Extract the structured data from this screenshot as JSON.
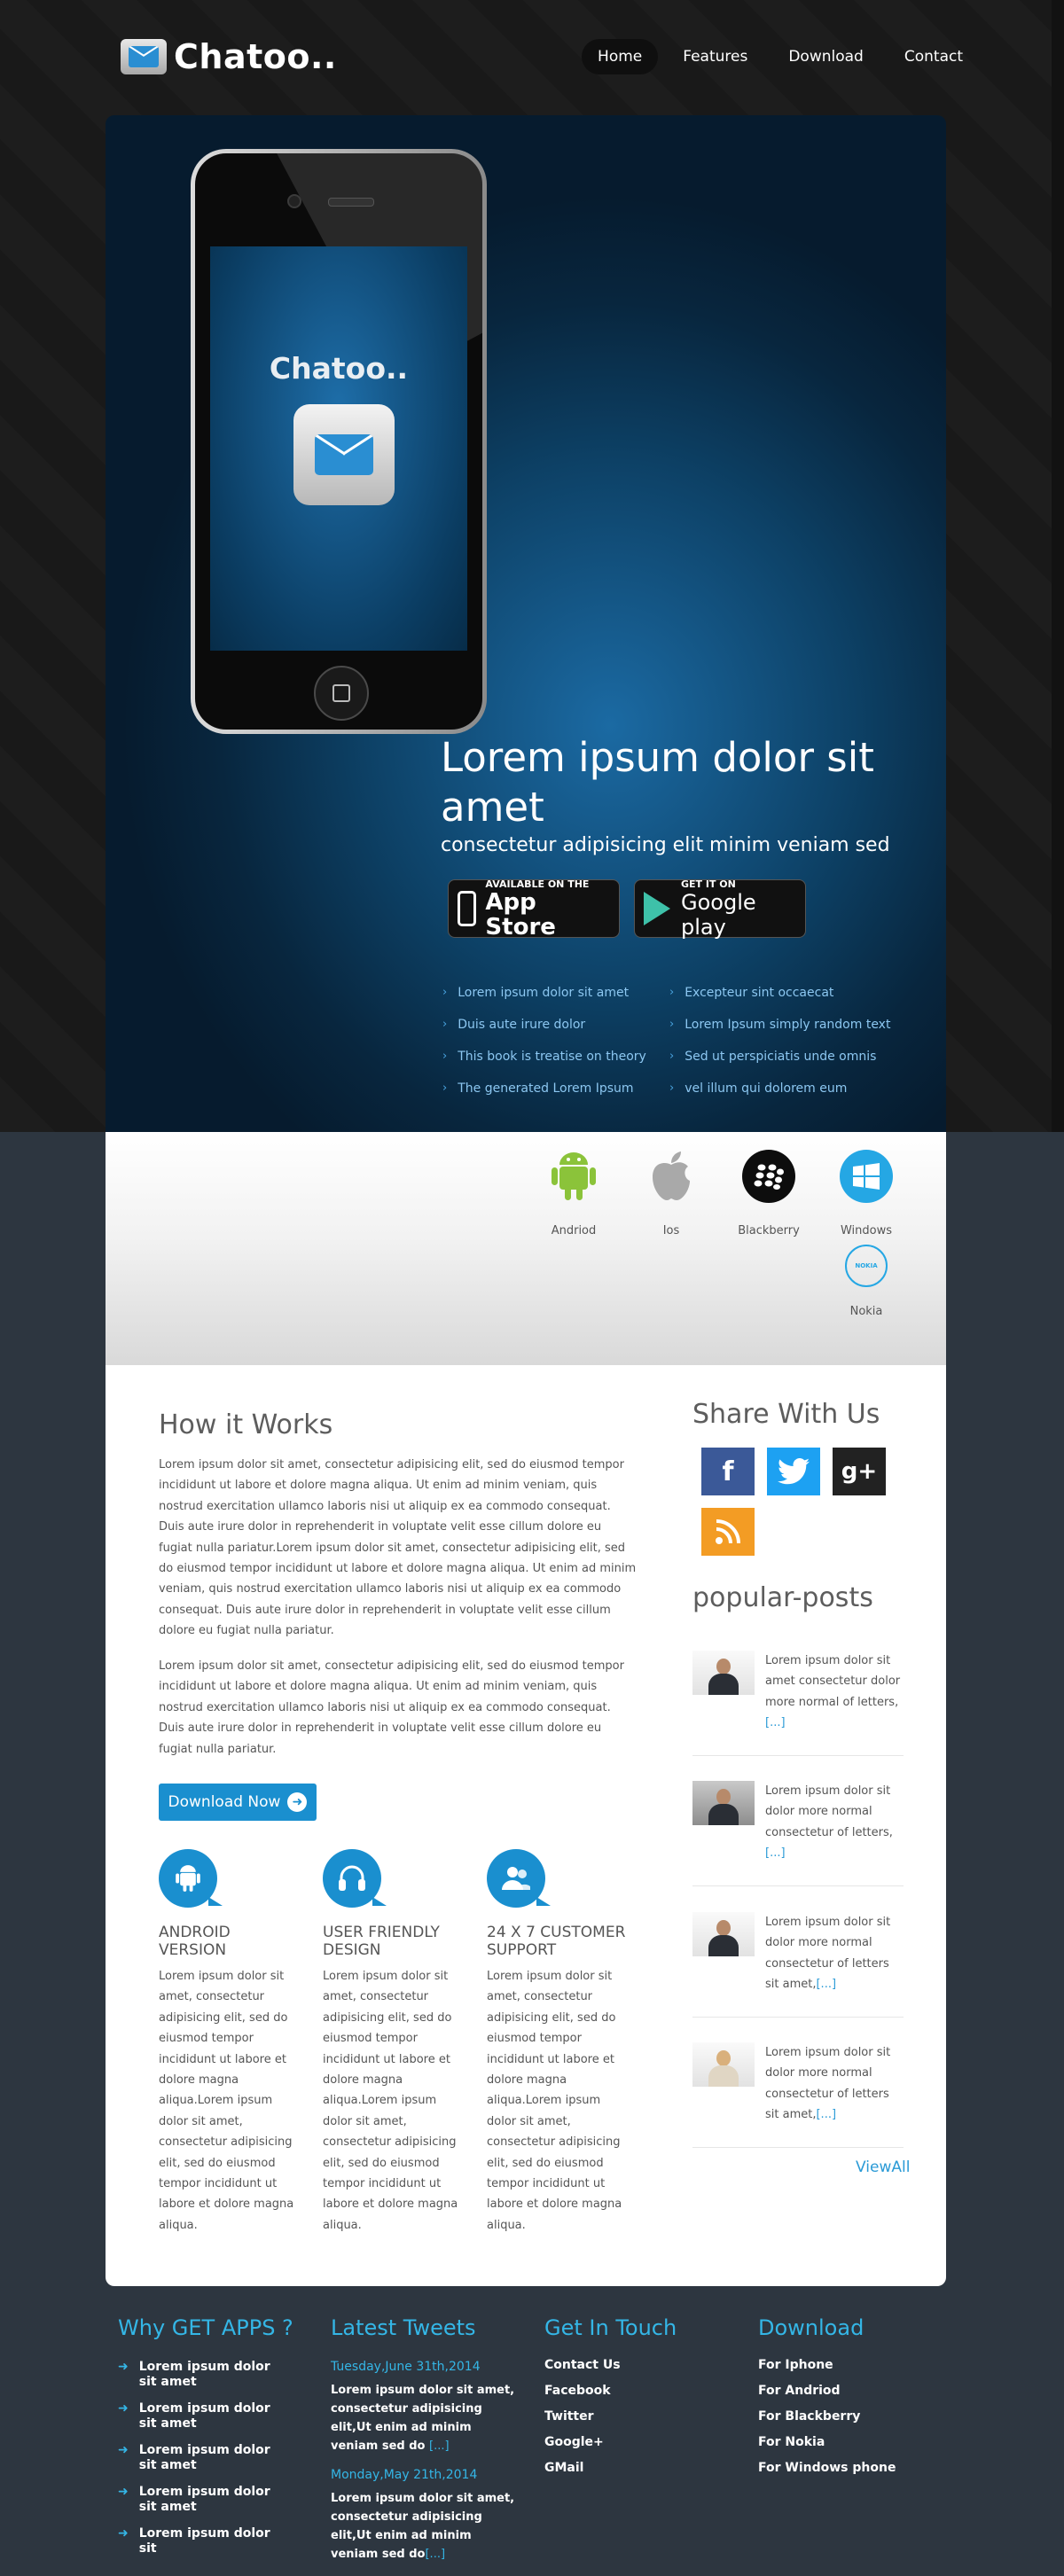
{
  "brand": {
    "name": "Chatoo..",
    "screen_title": "Chatoo.."
  },
  "nav": [
    {
      "label": "Home",
      "active": true
    },
    {
      "label": "Features"
    },
    {
      "label": "Download"
    },
    {
      "label": "Contact"
    }
  ],
  "hero": {
    "heading": "Lorem ipsum dolor sit amet",
    "subheading": "consectetur adipisicing elit minim veniam sed",
    "app_store": {
      "small": "AVAILABLE ON THE",
      "big": "App Store"
    },
    "google_play": {
      "small": "GET IT ON",
      "big": "Google play"
    },
    "features_left": [
      "Lorem ipsum dolor sit amet",
      "Duis aute irure dolor",
      "This book is treatise on theory",
      "The generated Lorem Ipsum"
    ],
    "features_right": [
      "Excepteur sint occaecat",
      "Lorem Ipsum simply random text",
      "Sed ut perspiciatis unde omnis",
      "vel illum qui dolorem eum"
    ]
  },
  "platforms": [
    {
      "label": "Andriod",
      "icon": "android-icon"
    },
    {
      "label": "Ios",
      "icon": "apple-icon"
    },
    {
      "label": "Blackberry",
      "icon": "blackberry-icon"
    },
    {
      "label": "Windows",
      "icon": "windows-icon"
    },
    {
      "label": "Nokia",
      "icon": "nokia-icon",
      "badge": "NOKIA"
    }
  ],
  "how": {
    "title": "How it Works",
    "para1": "Lorem ipsum dolor sit amet, consectetur adipisicing elit, sed do eiusmod tempor incididunt ut labore et dolore magna aliqua. Ut enim ad minim veniam, quis nostrud exercitation ullamco laboris nisi ut aliquip ex ea commodo consequat. Duis aute irure dolor in reprehenderit in voluptate velit esse cillum dolore eu fugiat nulla pariatur.Lorem ipsum dolor sit amet, consectetur adipisicing elit, sed do eiusmod tempor incididunt ut labore et dolore magna aliqua. Ut enim ad minim veniam, quis nostrud exercitation ullamco laboris nisi ut aliquip ex ea commodo consequat. Duis aute irure dolor in reprehenderit in voluptate velit esse cillum dolore eu fugiat nulla pariatur.",
    "para2": "Lorem ipsum dolor sit amet, consectetur adipisicing elit, sed do eiusmod tempor incididunt ut labore et dolore magna aliqua. Ut enim ad minim veniam, quis nostrud exercitation ullamco laboris nisi ut aliquip ex ea commodo consequat. Duis aute irure dolor in reprehenderit in voluptate velit esse cillum dolore eu fugiat nulla pariatur.",
    "download_label": "Download Now"
  },
  "features": [
    {
      "title": "ANDROID VERSION",
      "icon": "android-icon",
      "text": "Lorem ipsum dolor sit amet, consectetur adipisicing elit, sed do eiusmod tempor incididunt ut labore et dolore magna aliqua.Lorem ipsum dolor sit amet, consectetur adipisicing elit, sed do eiusmod tempor incididunt ut labore et dolore magna aliqua."
    },
    {
      "title": "USER FRIENDLY DESIGN",
      "icon": "headphones-icon",
      "text": "Lorem ipsum dolor sit amet, consectetur adipisicing elit, sed do eiusmod tempor incididunt ut labore et dolore magna aliqua.Lorem ipsum dolor sit amet, consectetur adipisicing elit, sed do eiusmod tempor incididunt ut labore et dolore magna aliqua."
    },
    {
      "title": "24 X 7 CUSTOMER SUPPORT",
      "icon": "support-icon",
      "text": "Lorem ipsum dolor sit amet, consectetur adipisicing elit, sed do eiusmod tempor incididunt ut labore et dolore magna aliqua.Lorem ipsum dolor sit amet, consectetur adipisicing elit, sed do eiusmod tempor incididunt ut labore et dolore magna aliqua."
    }
  ],
  "share": {
    "title": "Share With Us",
    "icons": [
      {
        "name": "facebook-icon",
        "glyph": "f",
        "color": "#3b5998"
      },
      {
        "name": "twitter-icon",
        "glyph": "t",
        "color": "#1da1f2"
      },
      {
        "name": "googleplus-icon",
        "glyph": "g+",
        "color": "#222222"
      },
      {
        "name": "rss-icon",
        "glyph": "rss",
        "color": "#f39c24"
      }
    ]
  },
  "popular": {
    "title": "popular-posts",
    "posts": [
      {
        "text": "Lorem ipsum dolor sit amet consectetur dolor more normal of letters,",
        "more": "[...]"
      },
      {
        "text": "Lorem ipsum dolor sit dolor more normal consectetur of letters,",
        "more": "[...]"
      },
      {
        "text": "Lorem ipsum dolor sit dolor more normal consectetur of letters sit amet,",
        "more": "[...]"
      },
      {
        "text": "Lorem ipsum dolor sit dolor more normal consectetur of letters sit amet,",
        "more": "[...]"
      }
    ],
    "view_all": "ViewAll"
  },
  "footer": {
    "why": {
      "title": "Why GET APPS ?",
      "items": [
        "Lorem ipsum dolor sit amet",
        "Lorem ipsum dolor sit amet",
        "Lorem ipsum dolor sit amet",
        "Lorem ipsum dolor sit amet",
        "Lorem ipsum dolor sit"
      ]
    },
    "tweets": {
      "title": "Latest Tweets",
      "items": [
        {
          "date": "Tuesday,June 31th,2014",
          "text": "Lorem ipsum dolor sit amet, consectetur adipisicing elit,Ut enim ad minim veniam sed do",
          "more": "[...]"
        },
        {
          "date": "Monday,May 21th,2014",
          "text": "Lorem ipsum dolor sit amet, consectetur adipisicing elit,Ut enim ad minim veniam sed do",
          "more": "[...]"
        }
      ]
    },
    "touch": {
      "title": "Get In Touch",
      "items": [
        "Contact Us",
        "Facebook",
        "Twitter",
        "Google+",
        "GMail"
      ]
    },
    "download": {
      "title": "Download",
      "items": [
        "For Iphone",
        "For Andriod",
        "For Blackberry",
        "For Nokia",
        "For Windows phone"
      ]
    }
  }
}
